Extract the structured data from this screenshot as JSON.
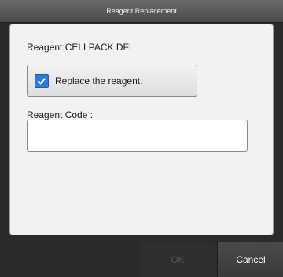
{
  "dialog": {
    "title": "Reagent Replacement",
    "reagent_label": "Reagent:CELLPACK DFL",
    "replace_checkbox": {
      "label": "Replace the reagent.",
      "checked": true
    },
    "reagent_code": {
      "label": "Reagent Code :",
      "value": "",
      "placeholder": ""
    },
    "buttons": {
      "ok": "OK",
      "ok_enabled": false,
      "cancel": "Cancel"
    }
  },
  "icons": {
    "checkbox": "checkmark-icon"
  },
  "colors": {
    "checkbox_fill": "#2a7cd6",
    "title_bar": "#5a5a5a",
    "panel": "#f2f2f2"
  }
}
